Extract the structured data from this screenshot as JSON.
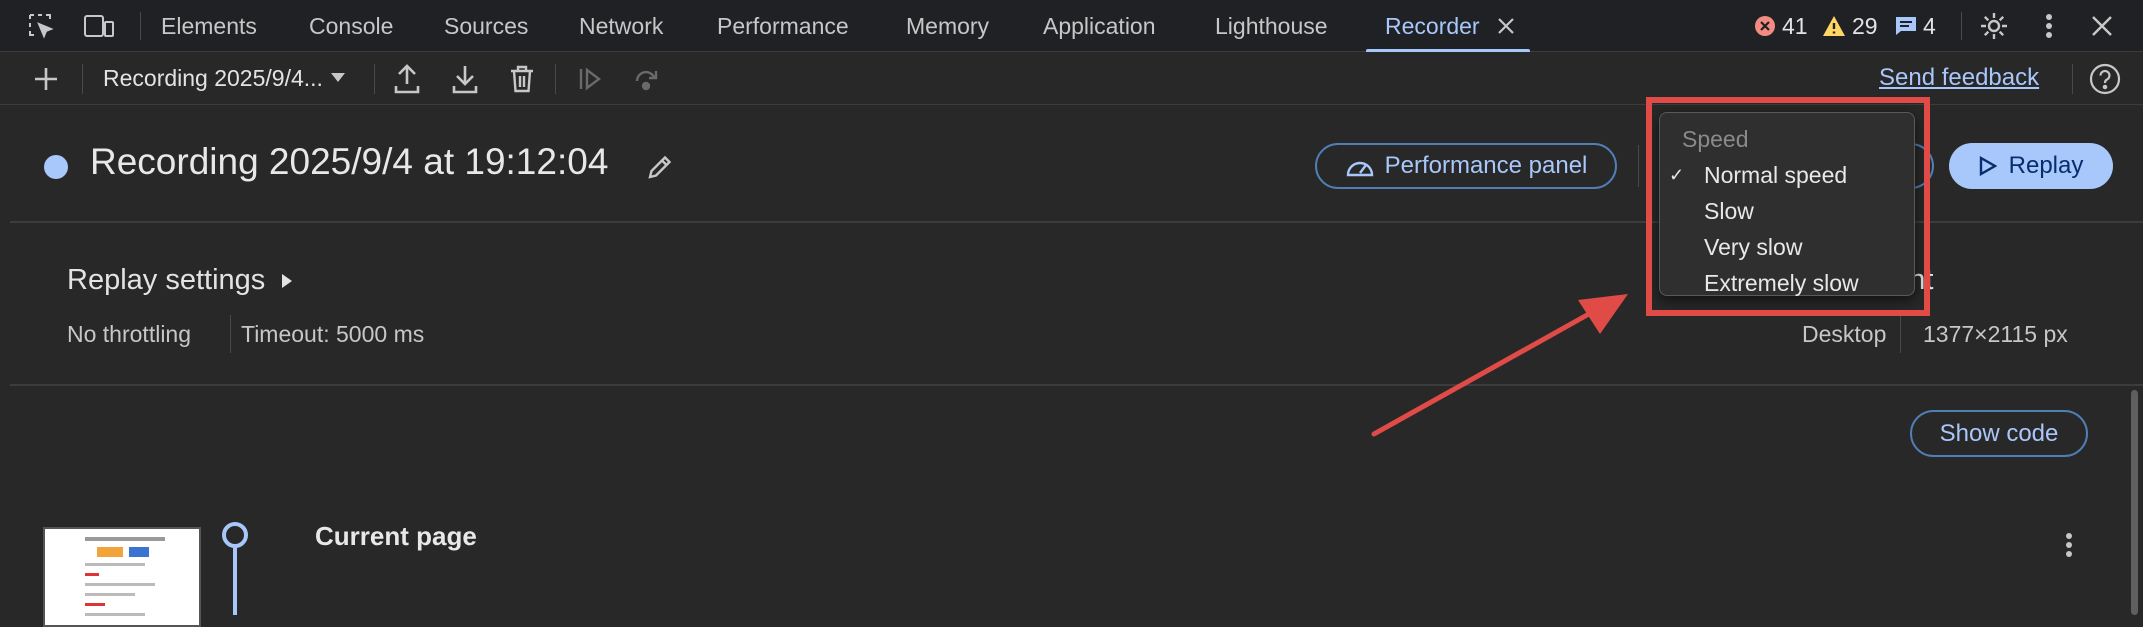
{
  "tabs": [
    {
      "label": "Elements"
    },
    {
      "label": "Console"
    },
    {
      "label": "Sources"
    },
    {
      "label": "Network"
    },
    {
      "label": "Performance"
    },
    {
      "label": "Memory"
    },
    {
      "label": "Application"
    },
    {
      "label": "Lighthouse"
    },
    {
      "label": "Recorder",
      "active": true
    }
  ],
  "status": {
    "errors": "41",
    "warnings": "29",
    "messages": "4"
  },
  "toolbar": {
    "recording_select": "Recording 2025/9/4...",
    "send_feedback": "Send feedback"
  },
  "recording": {
    "title": "Recording 2025/9/4 at 19:12:04",
    "performance_panel": "Performance panel",
    "replay": "Replay"
  },
  "replay_settings": {
    "heading": "Replay settings",
    "throttling": "No throttling",
    "timeout": "Timeout: 5000 ms"
  },
  "environment": {
    "heading_fragment": "nent",
    "device": "Desktop",
    "viewport": "1377×2115 px"
  },
  "show_code": "Show code",
  "step": {
    "title": "Current page"
  },
  "speed_menu": {
    "header": "Speed",
    "items": [
      {
        "label": "Normal speed",
        "checked": true
      },
      {
        "label": "Slow",
        "checked": false
      },
      {
        "label": "Very slow",
        "checked": false
      },
      {
        "label": "Extremely slow",
        "checked": false
      }
    ]
  },
  "colors": {
    "accent": "#a8c7fa",
    "error": "#f28b82",
    "warning": "#fdd663",
    "annotation": "#e04b47"
  }
}
